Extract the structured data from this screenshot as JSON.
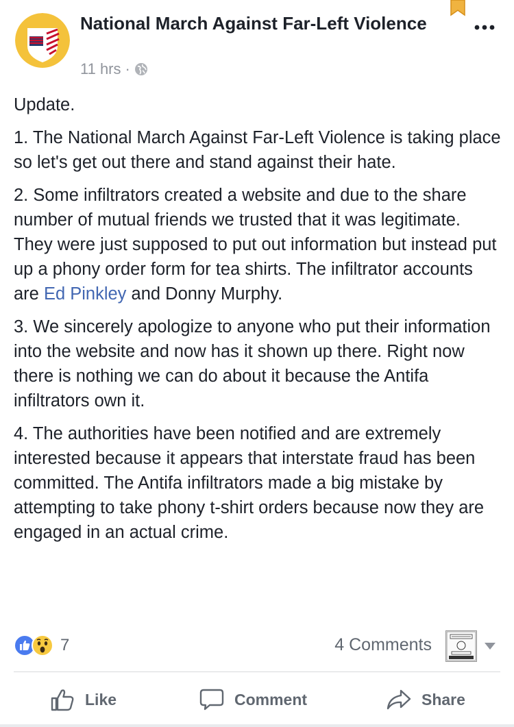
{
  "post": {
    "page_name": "National March Against Far-Left Violence",
    "timestamp": "11 hrs",
    "separator": "·",
    "privacy_icon": "globe-icon",
    "body": {
      "p1": "Update.",
      "p2": "1. The National March Against Far-Left Violence is taking place so let's get out there and stand against their hate.",
      "p3_before": "2. Some infiltrators created a website and due to the share number of mutual friends we trusted that it was legitimate. They were just supposed to put out information but instead put up a phony order form for tea shirts. The infiltrator accounts are ",
      "p3_link": "Ed Pinkley",
      "p3_after": " and Donny Murphy.",
      "p4": "3. We sincerely apologize to anyone who put their information into the website and now has it shown up there. Right now there is nothing we can do about it because the Antifa infiltrators own it.",
      "p5": "4. The authorities have been notified and are extremely interested because it appears that interstate fraud has been committed. The Antifa infiltrators made a big mistake by attempting to take phony t-shirt orders because now they are engaged in an actual crime."
    }
  },
  "reactions": {
    "icons": [
      "like-reaction-icon",
      "wow-reaction-icon"
    ],
    "count": "7",
    "comments": "4 Comments"
  },
  "actions": {
    "like": "Like",
    "comment": "Comment",
    "share": "Share"
  },
  "colors": {
    "link": "#4267b2",
    "muted": "#606770",
    "like_blue": "#4a7bef",
    "wow_yellow": "#f7c940",
    "avatar_yellow": "#f4c23b",
    "flag_red": "#c8102e"
  }
}
